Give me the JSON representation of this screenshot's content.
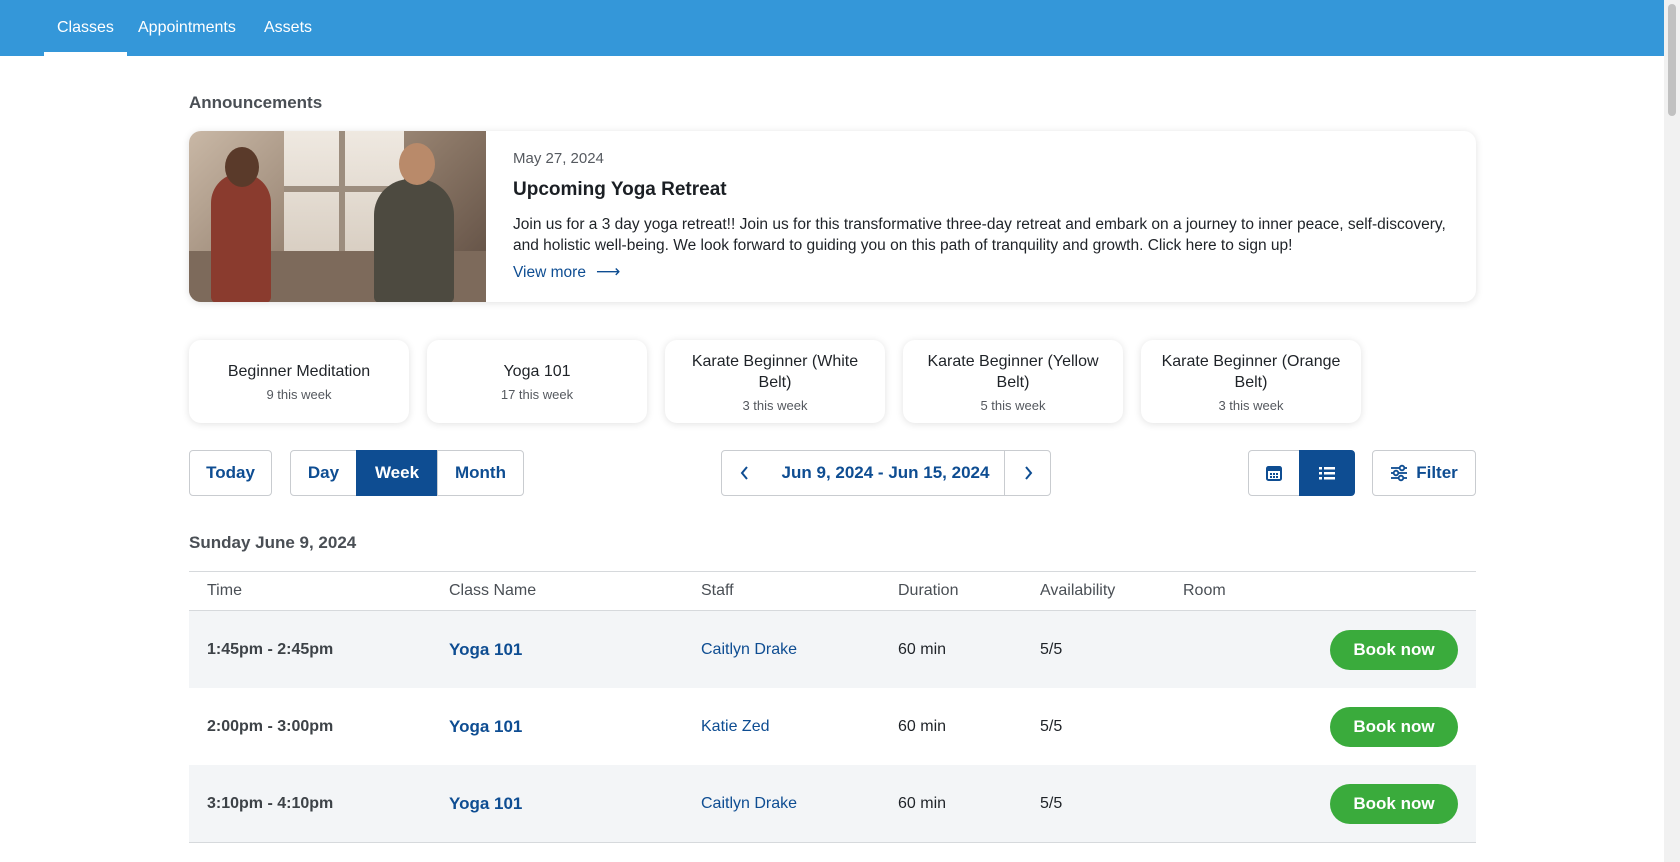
{
  "nav": {
    "tabs": [
      {
        "label": "Classes",
        "active": true
      },
      {
        "label": "Appointments",
        "active": false
      },
      {
        "label": "Assets",
        "active": false
      }
    ]
  },
  "announcements": {
    "section_title": "Announcements",
    "item": {
      "date": "May 27, 2024",
      "title": "Upcoming Yoga Retreat",
      "body": "Join us for a 3 day yoga retreat!! Join us for this transformative three-day retreat and embark on a journey to inner peace, self-discovery, and holistic well-being. We look forward to guiding you on this path of tranquility and growth. Click here to sign up!",
      "link_label": "View more",
      "link_arrow": "⟶"
    }
  },
  "class_cards": [
    {
      "name": "Beginner Meditation",
      "count": "9 this week"
    },
    {
      "name": "Yoga 101",
      "count": "17 this week"
    },
    {
      "name": "Karate Beginner (White Belt)",
      "count": "3 this week"
    },
    {
      "name": "Karate Beginner (Yellow Belt)",
      "count": "5 this week"
    },
    {
      "name": "Karate Beginner (Orange Belt)",
      "count": "3 this week"
    }
  ],
  "toolbar": {
    "today_label": "Today",
    "view_modes": [
      "Day",
      "Week",
      "Month"
    ],
    "active_view": "Week",
    "date_range": "Jun 9, 2024 - Jun 15, 2024",
    "prev_icon": "chevron-left-icon",
    "next_icon": "chevron-right-icon",
    "calendar_view_icon": "calendar-icon",
    "list_view_icon": "list-icon",
    "active_display": "list",
    "filter_label": "Filter",
    "filter_icon": "sliders-icon"
  },
  "schedule": {
    "day_title": "Sunday June 9, 2024",
    "columns": [
      "Time",
      "Class Name",
      "Staff",
      "Duration",
      "Availability",
      "Room"
    ],
    "rows": [
      {
        "time": "1:45pm - 2:45pm",
        "class_name": "Yoga 101",
        "staff": "Caitlyn Drake",
        "duration": "60 min",
        "availability": "5/5",
        "room": "",
        "action": "Book now"
      },
      {
        "time": "2:00pm - 3:00pm",
        "class_name": "Yoga 101",
        "staff": "Katie Zed",
        "duration": "60 min",
        "availability": "5/5",
        "room": "",
        "action": "Book now"
      },
      {
        "time": "3:10pm - 4:10pm",
        "class_name": "Yoga 101",
        "staff": "Caitlyn Drake",
        "duration": "60 min",
        "availability": "5/5",
        "room": "",
        "action": "Book now"
      }
    ]
  },
  "colors": {
    "nav_bg": "#3497d9",
    "primary": "#0e4d92",
    "book_button": "#3aab3c"
  }
}
